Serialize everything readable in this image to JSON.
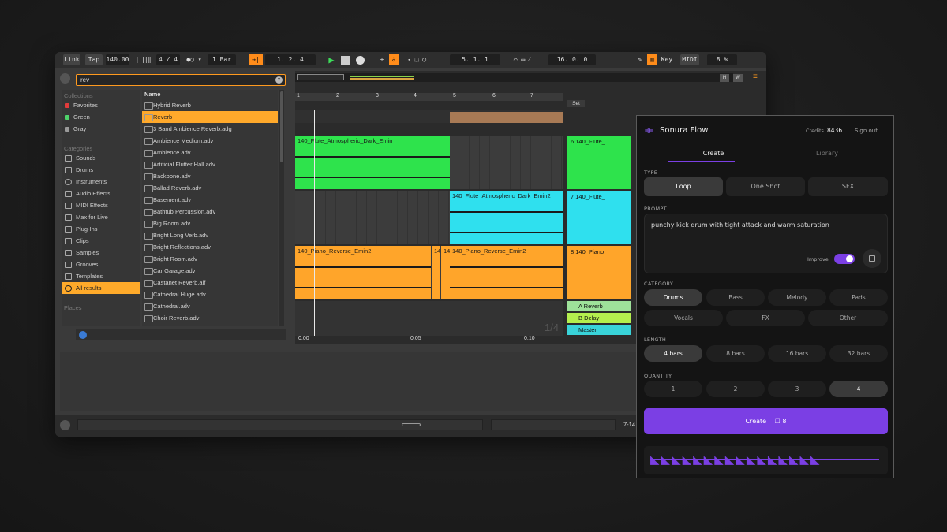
{
  "transport": {
    "link": "Link",
    "tap": "Tap",
    "tempo": "140.00",
    "signature": "4 / 4",
    "quantize": "1 Bar",
    "position": "1.  2.  4",
    "loop_start": "5.  1.  1",
    "loop_length": "16.  0.  0",
    "key": "Key",
    "midi": "MIDI",
    "cpu": "8 %"
  },
  "browser": {
    "search_value": "rev",
    "collections_header": "Collections",
    "collections": [
      {
        "label": "Favorites",
        "color": "#e23b3b"
      },
      {
        "label": "Green",
        "color": "#4ed36a"
      },
      {
        "label": "Gray",
        "color": "#9a9a9a"
      }
    ],
    "categories_header": "Categories",
    "categories": [
      "Sounds",
      "Drums",
      "Instruments",
      "Audio Effects",
      "MIDI Effects",
      "Max for Live",
      "Plug-Ins",
      "Clips",
      "Samples",
      "Grooves",
      "Templates",
      "All results"
    ],
    "places_header": "Places",
    "name_header": "Name",
    "files": [
      "Hybrid Reverb",
      "Reverb",
      "3 Band Ambience Reverb.adg",
      "Ambience Medium.adv",
      "Ambience.adv",
      "Artificial Flutter Hall.adv",
      "Backbone.adv",
      "Ballad Reverb.adv",
      "Basement.adv",
      "Bathtub Percussion.adv",
      "Big Room.adv",
      "Bright Long Verb.adv",
      "Bright Reflections.adv",
      "Bright Room.adv",
      "Car Garage.adv",
      "Castanet Reverb.aif",
      "Cathedral Huge.adv",
      "Cathedral.adv",
      "Choir Reverb.adv"
    ]
  },
  "arrangement": {
    "ruler": [
      "1",
      "2",
      "3",
      "4",
      "5",
      "6",
      "7"
    ],
    "set_label": "Set",
    "time_labels": [
      "0:00",
      "0:05",
      "0:10"
    ],
    "fraction": "1/4",
    "clips": [
      {
        "label": "140_Flute_Atmospheric_Dark_Emin",
        "color": "#2ee34c"
      },
      {
        "label": "140_Flute_Atmospheric_Dark_Emin2",
        "color": "#2fe0ee"
      },
      {
        "label": "140_Piano_Reverse_Emin2",
        "color": "#ffa52a"
      },
      {
        "label": "14",
        "color": "#ffa52a"
      },
      {
        "label": "14",
        "color": "#ffa52a"
      },
      {
        "label": "140_Piano_Reverse_Emin2",
        "color": "#ffa52a"
      }
    ],
    "tracks": [
      {
        "label": "6 140_Flute_",
        "color": "#2ee34c"
      },
      {
        "label": "7 140_Flute_",
        "color": "#2fe0ee"
      },
      {
        "label": "8 140_Piano_",
        "color": "#ffa52a"
      },
      {
        "label": "A Reverb",
        "color": "#9ee29a"
      },
      {
        "label": "B Delay",
        "color": "#b4ef4e"
      },
      {
        "label": "Master",
        "color": "#39d3d9"
      }
    ],
    "bottom_right": "7-14"
  },
  "plugin": {
    "title": "Sonura Flow",
    "credits_label": "Credits",
    "credits_value": "8436",
    "sign_out": "Sign out",
    "tabs": [
      "Create",
      "Library"
    ],
    "type_label": "TYPE",
    "types": [
      "Loop",
      "One Shot",
      "SFX"
    ],
    "prompt_label": "PROMPT",
    "prompt_text": "punchy kick drum with tight attack and warm saturation",
    "improve_label": "Improve",
    "category_label": "CATEGORY",
    "categories_row1": [
      "Drums",
      "Bass",
      "Melody",
      "Pads"
    ],
    "categories_row2": [
      "Vocals",
      "FX",
      "Other"
    ],
    "length_label": "LENGTH",
    "lengths": [
      "4 bars",
      "8 bars",
      "16 bars",
      "32 bars"
    ],
    "quantity_label": "QUANTITY",
    "quantities": [
      "1",
      "2",
      "3",
      "4"
    ],
    "create_label": "Create",
    "create_cost": "8",
    "accent": "#7b3fe4"
  }
}
